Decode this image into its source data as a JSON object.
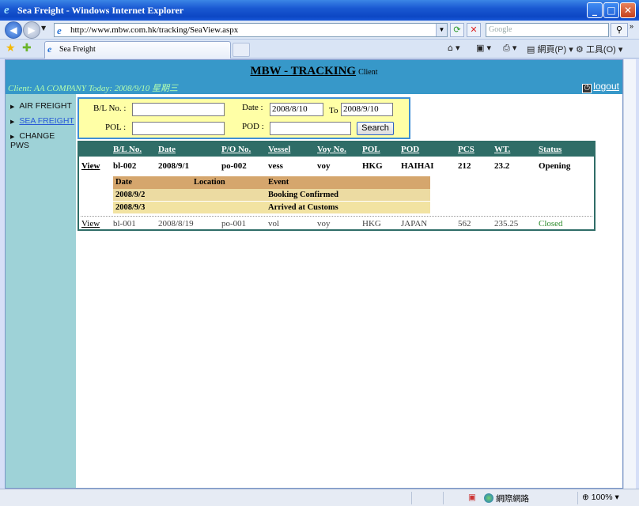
{
  "window": {
    "title": "Sea Freight - Windows Internet Explorer",
    "minimize_glyph": "_",
    "maximize_glyph": "□",
    "close_glyph": "✕"
  },
  "addressbar": {
    "url": "http://www.mbw.com.hk/tracking/SeaView.aspx",
    "search_placeholder": "Google"
  },
  "tabs": [
    {
      "label": "Sea Freight"
    }
  ],
  "toolbar": {
    "page_label": "網頁(P)",
    "tools_label": "工具(O)"
  },
  "header": {
    "title": "MBW - TRACKING",
    "subtitle": "Client",
    "client_info": "Client: AA COMPANY Today: 2008/9/10 星期三",
    "logout_label": "logout"
  },
  "sidebar": {
    "items": [
      {
        "label": "AIR FREIGHT"
      },
      {
        "label": "SEA FREIGHT"
      },
      {
        "label": "CHANGE PWS"
      }
    ]
  },
  "search": {
    "bl_label": "B/L No. :",
    "bl_value": "",
    "date_label": "Date :",
    "date_from": "2008/8/10",
    "to_label": "To",
    "date_to": "2008/9/10",
    "pol_label": "POL :",
    "pol_value": "",
    "pod_label": "POD :",
    "pod_value": "",
    "button_label": "Search"
  },
  "results": {
    "columns": [
      "B/L No.",
      "Date",
      "P/O No.",
      "Vessel",
      "Voy No.",
      "POL",
      "POD",
      "PCS",
      "WT.",
      "Status"
    ],
    "rows": [
      {
        "view": "View",
        "bl": "bl-002",
        "date": "2008/9/1",
        "po": "po-002",
        "vessel": "vess",
        "voy": "voy",
        "pol": "HKG",
        "pod": "HAIHAI",
        "pcs": "212",
        "wt": "23.2",
        "status": "Opening"
      },
      {
        "view": "View",
        "bl": "bl-001",
        "date": "2008/8/19",
        "po": "po-001",
        "vessel": "vol",
        "voy": "voy",
        "pol": "HKG",
        "pod": "JAPAN",
        "pcs": "562",
        "wt": "235.25",
        "status": "Closed"
      }
    ],
    "events": {
      "columns": [
        "Date",
        "Location",
        "Event"
      ],
      "rows": [
        {
          "date": "2008/9/2",
          "location": "",
          "event": "Booking Confirmed"
        },
        {
          "date": "2008/9/3",
          "location": "",
          "event": "Arrived at Customs"
        }
      ]
    }
  },
  "statusbar": {
    "zone": "網際網路",
    "zoom": "100%"
  },
  "colors": {
    "header_bg": "#3798c9",
    "sidebar_bg": "#9ed2d7",
    "search_bg": "#ffffa6",
    "table_head": "#2f6d67",
    "event_head": "#d5a66d",
    "event_row": "#ecdba2"
  }
}
